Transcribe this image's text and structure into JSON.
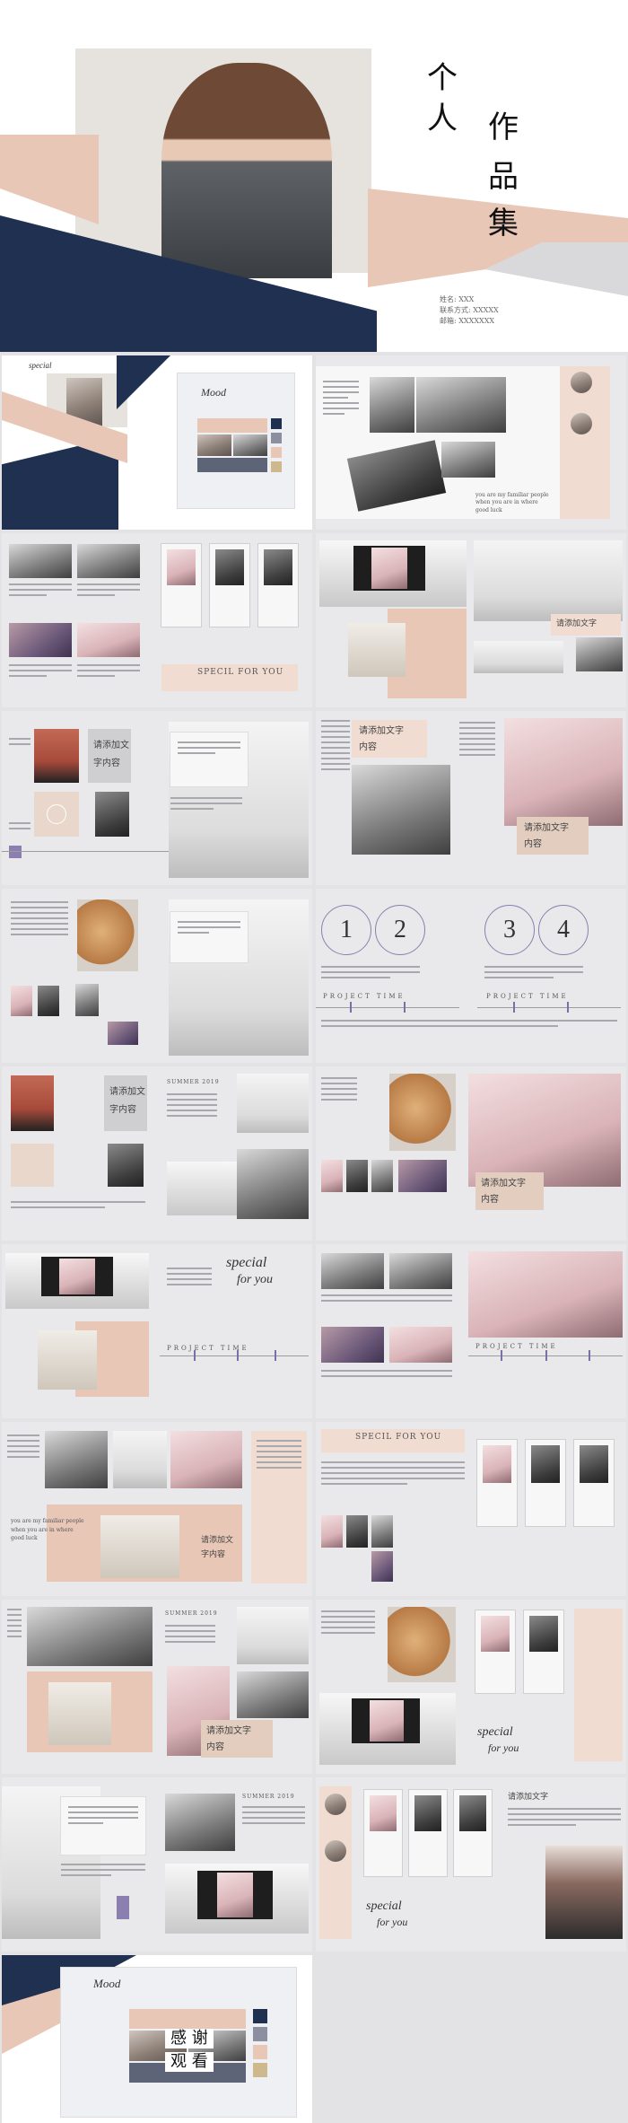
{
  "cover": {
    "title_chars": [
      "个",
      "人",
      "作",
      "品",
      "集"
    ],
    "info_lines": [
      "姓名: XXX",
      "联系方式: XXXXX",
      "邮箱: XXXXXXX"
    ]
  },
  "mood": {
    "label": "Mood"
  },
  "special": {
    "line1": "special",
    "line2": "for you"
  },
  "special_caps": "SPECIL FOR YOU",
  "tagline": {
    "lines": [
      "you are my familiar people",
      "when you are in where",
      "good luck"
    ]
  },
  "placeholder_cn": {
    "line1": "请添加文",
    "line2": "字内容"
  },
  "placeholder_cn_b": {
    "line1": "请添加文字",
    "line2": "内容"
  },
  "numbers": [
    "1",
    "2",
    "3",
    "4"
  ],
  "project_time": "PROJECT TIME",
  "summer": "SUMMER 2019",
  "special_script": {
    "line1": "special",
    "line2": "for you"
  },
  "thanks": {
    "line1": "感 谢",
    "line2": "观 看"
  },
  "colors": {
    "navy": "#1f3050",
    "peach": "#e8c7b7",
    "gray": "#9a9aa0",
    "accent_purple": "#8b7fb0"
  }
}
